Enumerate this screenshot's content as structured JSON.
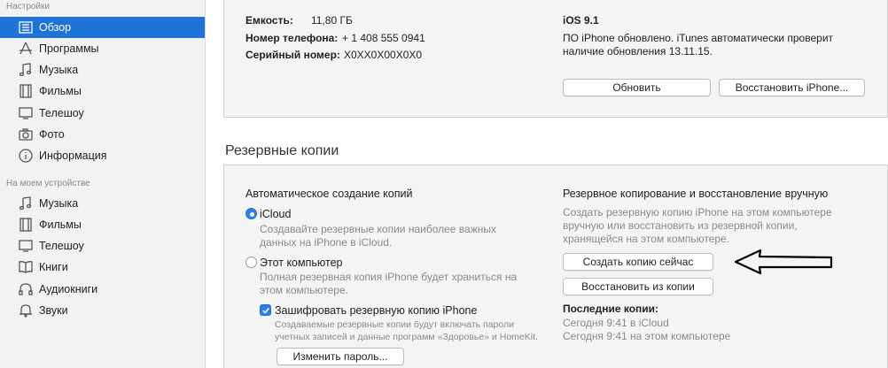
{
  "sidebar": {
    "section_settings": "Настройки",
    "section_device": "На моем устройстве",
    "settings_items": [
      {
        "label": "Обзор",
        "icon": "summary-icon",
        "selected": true
      },
      {
        "label": "Программы",
        "icon": "apps-icon"
      },
      {
        "label": "Музыка",
        "icon": "music-note-icon"
      },
      {
        "label": "Фильмы",
        "icon": "film-icon"
      },
      {
        "label": "Телешоу",
        "icon": "tv-icon"
      },
      {
        "label": "Фото",
        "icon": "camera-icon"
      },
      {
        "label": "Информация",
        "icon": "info-icon"
      }
    ],
    "device_items": [
      {
        "label": "Музыка",
        "icon": "music-note-icon"
      },
      {
        "label": "Фильмы",
        "icon": "film-icon"
      },
      {
        "label": "Телешоу",
        "icon": "tv-icon"
      },
      {
        "label": "Книги",
        "icon": "book-icon"
      },
      {
        "label": "Аудиокниги",
        "icon": "audiobook-icon"
      },
      {
        "label": "Звуки",
        "icon": "bell-icon"
      }
    ]
  },
  "device_info": {
    "capacity_label": "Емкость:",
    "capacity_value": "11,80 ГБ",
    "phone_label": "Номер телефона:",
    "phone_value": "+ 1 408 555 0941",
    "serial_label": "Серийный номер:",
    "serial_value": "X0XX0X00X0X0",
    "ios_version": "iOS 9.1",
    "update_status_line1": "ПО iPhone обновлено. iTunes автоматически проверит",
    "update_status_line2": "наличие обновления 13.11.15.",
    "update_button": "Обновить",
    "restore_button": "Восстановить iPhone..."
  },
  "backups": {
    "heading": "Резервные копии",
    "auto_heading": "Автоматическое создание копий",
    "icloud_label": "iCloud",
    "icloud_desc_line1": "Создавайте резервные копии наиболее важных",
    "icloud_desc_line2": "данных на iPhone в iCloud.",
    "computer_label": "Этот компьютер",
    "computer_desc_line1": "Полная резервная копия iPhone будет храниться на",
    "computer_desc_line2": "этом компьютере.",
    "encrypt_label": "Зашифровать резервную копию iPhone",
    "encrypt_desc_line1": "Создаваемые резервные копии будут включать пароли",
    "encrypt_desc_line2": "учетных записей и данные программ «Здоровье» и HomeKit.",
    "change_password_button": "Изменить пароль...",
    "manual_heading": "Резервное копирование и восстановление вручную",
    "manual_desc_line1": "Создать резервную копию iPhone на этом компьютере",
    "manual_desc_line2": "вручную или восстановить из резервной копии,",
    "manual_desc_line3": "хранящейся на этом компьютере.",
    "backup_now_button": "Создать копию сейчас",
    "restore_backup_button": "Восстановить из копии",
    "latest_heading": "Последние копии:",
    "latest_icloud": "Сегодня 9:41 в iCloud",
    "latest_computer": "Сегодня 9:41 на этом компьютере"
  },
  "colors": {
    "accent": "#1e74d6",
    "sidebar_bg": "#f2f2f2",
    "panel_bg": "#f4f4f4"
  }
}
